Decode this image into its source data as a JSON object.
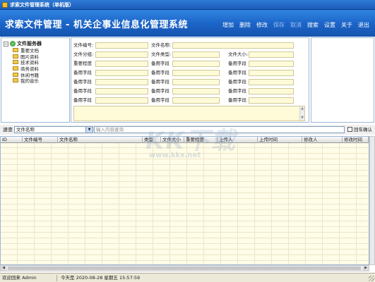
{
  "window": {
    "title": "求索文件管理系统（单机版）"
  },
  "banner": {
    "app_title": "求索文件管理 - 机关企事业信息化管理系统"
  },
  "toolbar": {
    "add": "增加",
    "delete": "删除",
    "edit": "修改",
    "save": "保存",
    "cancel": "取消",
    "search": "搜索",
    "settings": "设置",
    "about": "关于",
    "exit": "退出"
  },
  "tree": {
    "root": "文件服务器",
    "items": [
      {
        "label": "重要文档"
      },
      {
        "label": "图片资料"
      },
      {
        "label": "技术资料"
      },
      {
        "label": "商务资料"
      },
      {
        "label": "休闲书籍"
      },
      {
        "label": "我的音乐"
      }
    ]
  },
  "form": {
    "file_no": "文件编号:",
    "file_name": "文件名称:",
    "file_category": "文件分组:",
    "file_type": "文件类型:",
    "file_size": "文件大小:",
    "importance": "重要程度",
    "spare_field": "备用字段"
  },
  "search": {
    "label": "速查",
    "field_selected": "文件名称",
    "placeholder": "输入内容查询",
    "enter_confirm": "回车确认"
  },
  "grid": {
    "columns": [
      "ID",
      "文件编号",
      "文件名称",
      "类型",
      "文件大小",
      "重要程度",
      "上传人",
      "上传时间",
      "修改人",
      "修改时间"
    ]
  },
  "status": {
    "welcome": "欢迎回来 Admin",
    "today": "今天是 2020-08-28 星期五 15:57:59"
  },
  "watermark": {
    "big": "KK下载",
    "small": "www.kkx.net"
  }
}
